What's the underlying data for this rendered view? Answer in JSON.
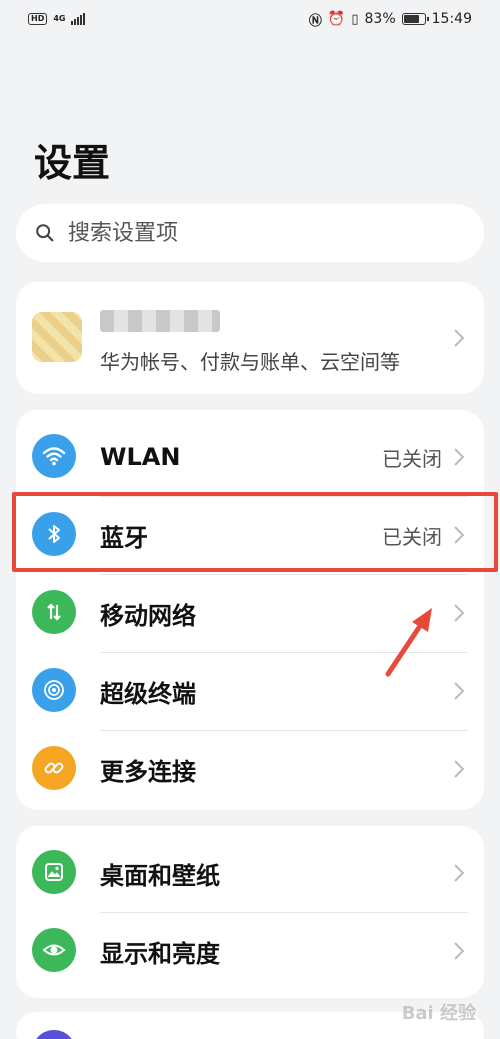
{
  "status_bar": {
    "hd": "HD",
    "network": "4G",
    "battery_percent": "83%",
    "battery_level": 0.83,
    "time": "15:49"
  },
  "page": {
    "title": "设置"
  },
  "search": {
    "placeholder": "搜索设置项"
  },
  "account": {
    "subtitle": "华为帐号、付款与账单、云空间等"
  },
  "connectivity": [
    {
      "label": "WLAN",
      "value": "已关闭",
      "icon": "wifi-icon",
      "color": "#3aa0ea"
    },
    {
      "label": "蓝牙",
      "value": "已关闭",
      "icon": "bluetooth-icon",
      "color": "#3aa0ea"
    },
    {
      "label": "移动网络",
      "value": "",
      "icon": "mobile-data-icon",
      "color": "#3cb85a"
    },
    {
      "label": "超级终端",
      "value": "",
      "icon": "super-device-icon",
      "color": "#3aa0ea"
    },
    {
      "label": "更多连接",
      "value": "",
      "icon": "link-icon",
      "color": "#f5a623"
    }
  ],
  "display": [
    {
      "label": "桌面和壁纸",
      "icon": "wallpaper-icon",
      "color": "#3cb85a"
    },
    {
      "label": "显示和亮度",
      "icon": "eye-icon",
      "color": "#3cb85a"
    }
  ],
  "colors": {
    "highlight": "#e84a3a",
    "background": "#f1f3f5"
  },
  "watermark": "Bai 经验"
}
